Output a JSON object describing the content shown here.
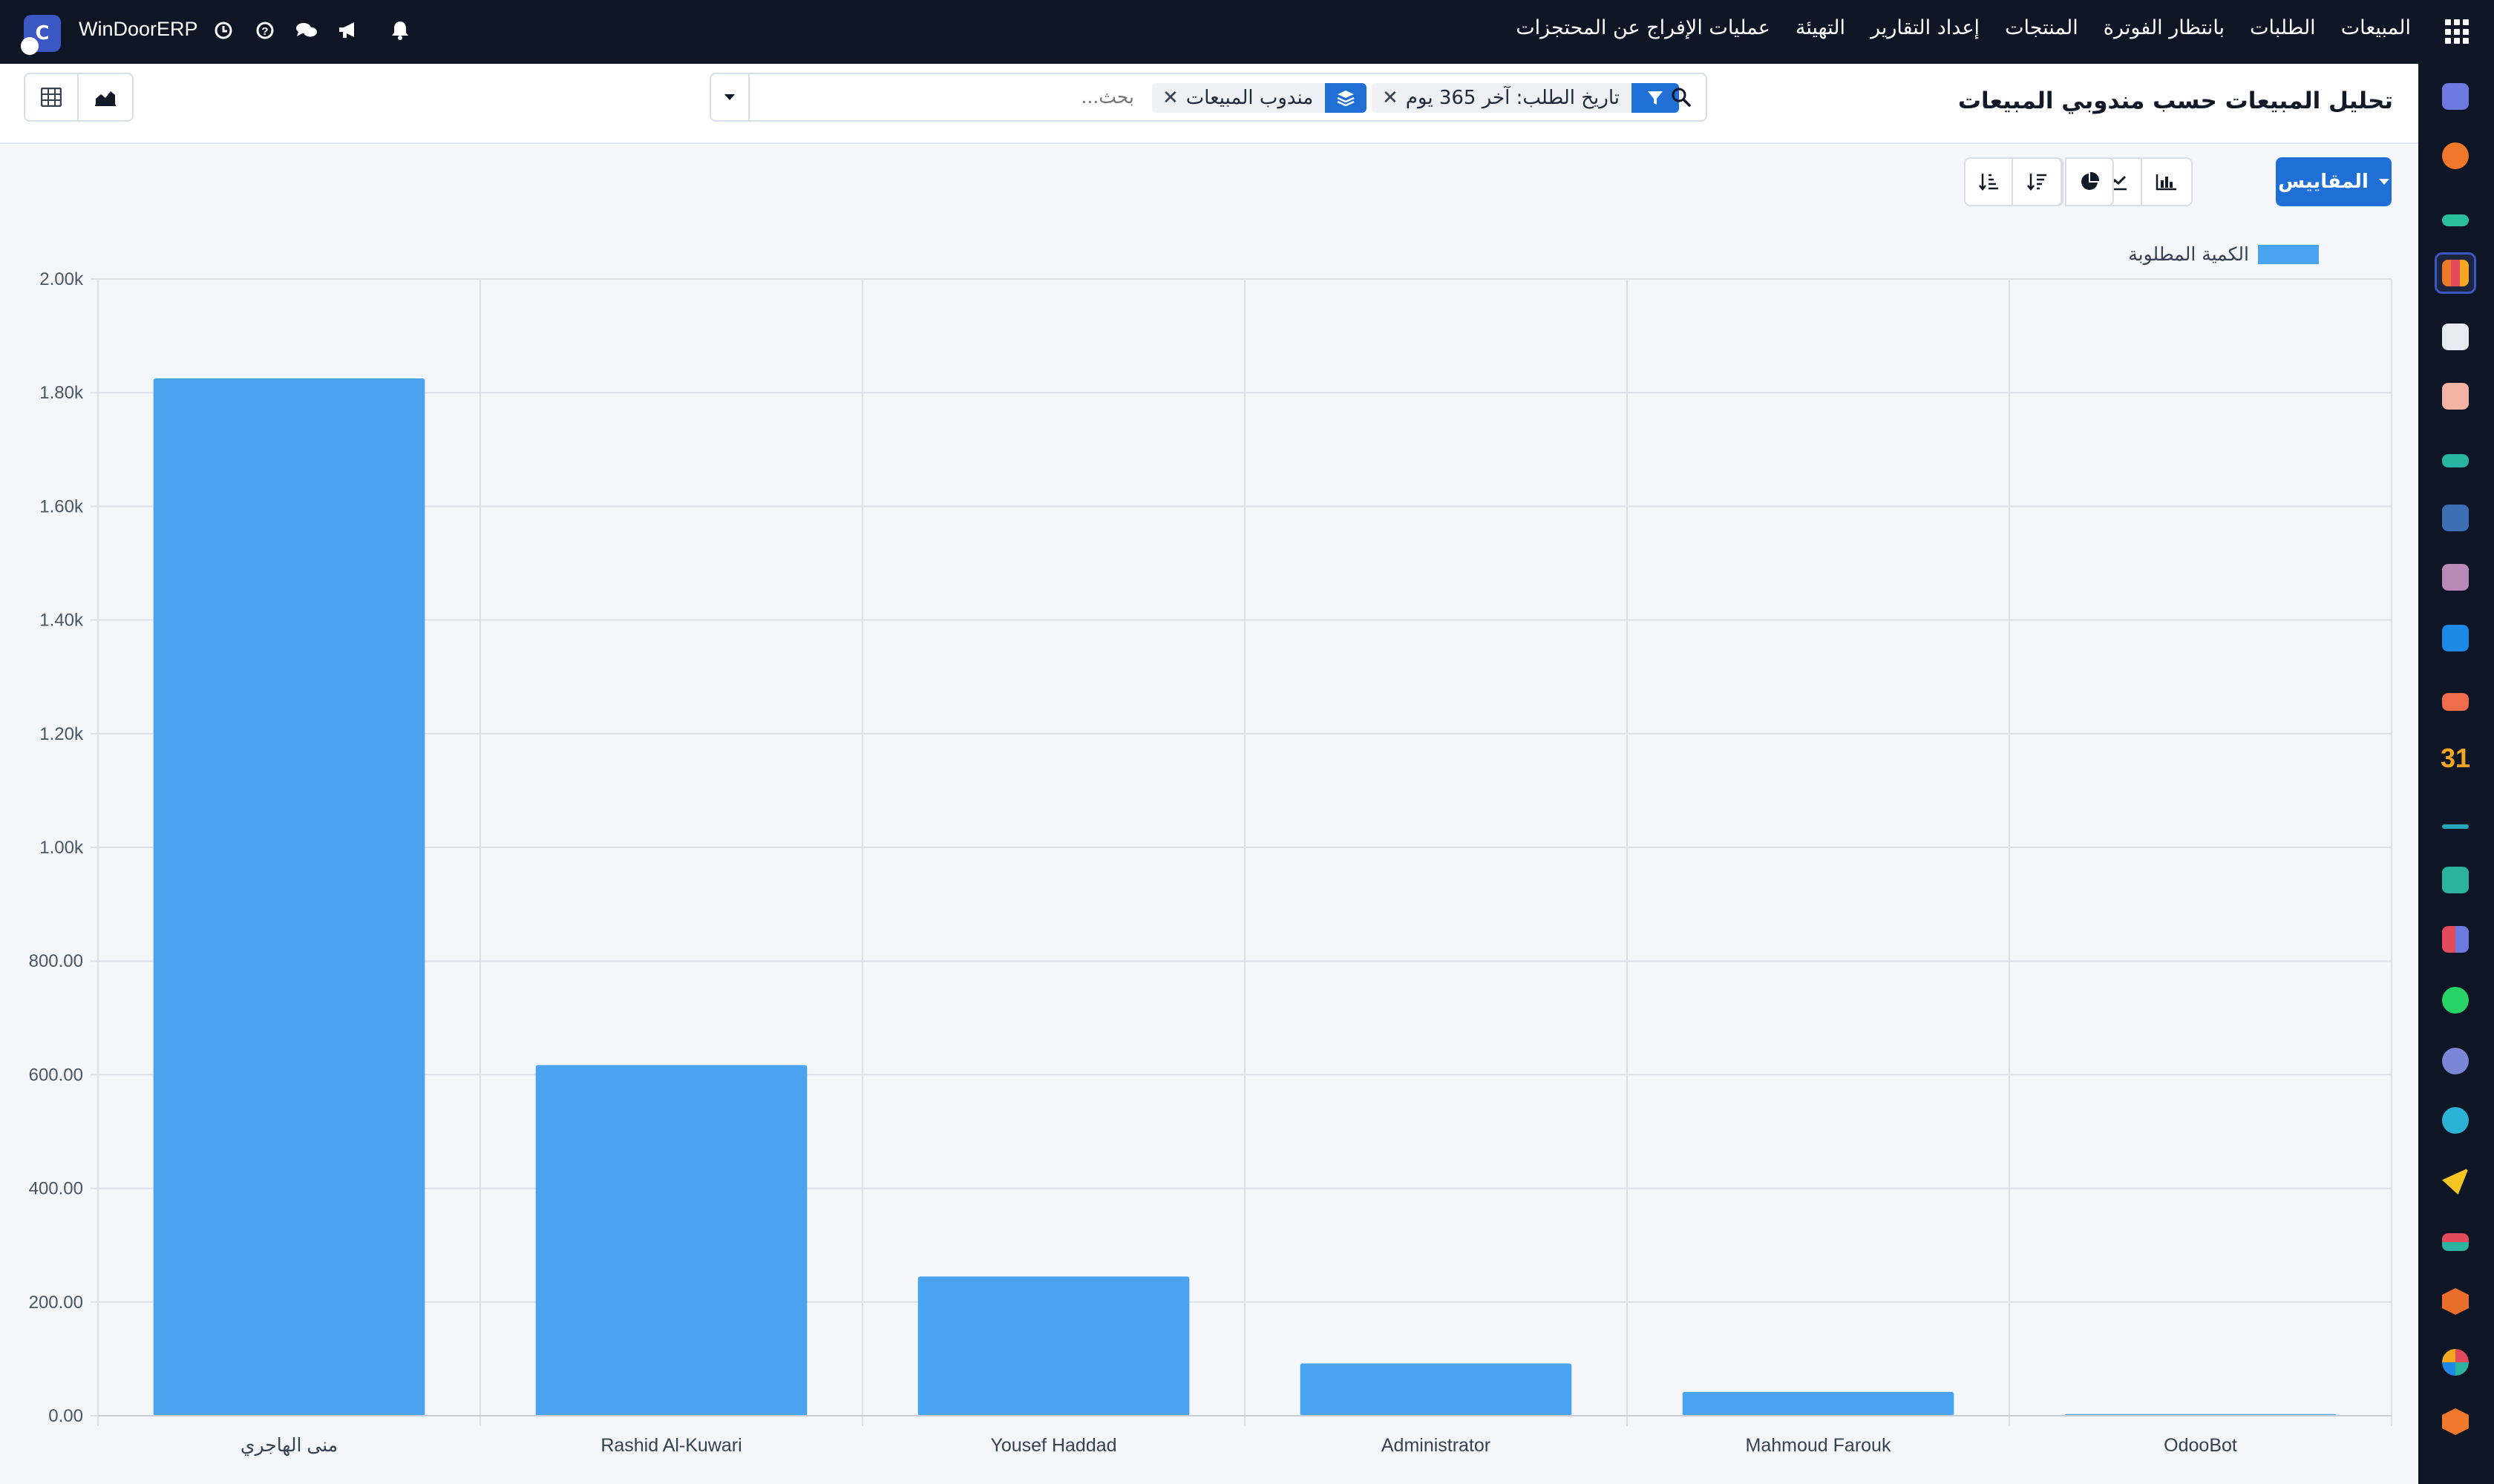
{
  "topbar": {
    "brand_name": "WinDoorERP",
    "menu": [
      "المبيعات",
      "الطلبات",
      "بانتظار الفوترة",
      "المنتجات",
      "إعداد التقارير",
      "التهيئة",
      "عمليات الإفراج عن المحتجزات"
    ]
  },
  "control": {
    "title": "تحليل المبيعات حسب مندوبي المبيعات",
    "search_placeholder": "بحث...",
    "facets": {
      "filter": "تاريخ الطلب: آخر 365 يوم",
      "groupby": "مندوب المبيعات"
    },
    "measures_label": "المقاييس"
  },
  "colors": {
    "bar": "#4aa3ef",
    "primary": "#1f6fd6",
    "navbar": "#0e1525"
  },
  "chart_data": {
    "type": "bar",
    "categories": [
      "منى الهاجري",
      "Rashid Al-Kuwari",
      "Yousef Haddad",
      "Administrator",
      "Mahmoud Farouk",
      "OdooBot"
    ],
    "series": [
      {
        "name": "الكمية المطلوبة",
        "values": [
          1825,
          617,
          245,
          92,
          42,
          3
        ]
      }
    ],
    "ylim": [
      0,
      2000
    ],
    "yticks": [
      0,
      200,
      400,
      600,
      800,
      1000,
      1200,
      1400,
      1600,
      1800,
      2000
    ],
    "ytick_labels": [
      "0.00",
      "200.00",
      "400.00",
      "600.00",
      "800.00",
      "1.00k",
      "1.20k",
      "1.40k",
      "1.60k",
      "1.80k",
      "2.00k"
    ],
    "grid": true,
    "legend": "top-right"
  }
}
